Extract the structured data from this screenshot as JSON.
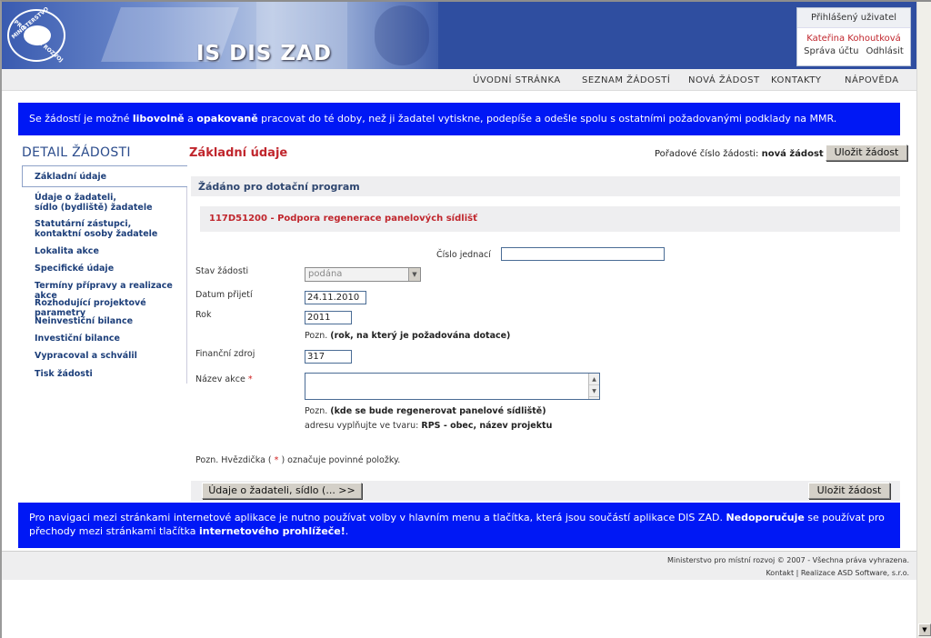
{
  "header": {
    "logo_line1": "MINISTERSTVO",
    "logo_line2": "PRO MÍSTNÍ ROZVOJ",
    "app_title": "IS DIS ZAD",
    "user_box": {
      "heading": "Přihlášený uživatel",
      "user_name": "Kateřina Kohoutková",
      "account_link": "Správa účtu",
      "logout_link": "Odhlásit"
    }
  },
  "nav": {
    "items": [
      "ÚVODNÍ STRÁNKA",
      "SEZNAM ŽÁDOSTÍ",
      "NOVÁ ŽÁDOST",
      "KONTAKTY",
      "NÁPOVĚDA"
    ]
  },
  "info_top": {
    "p1": "Se žádostí je možné ",
    "b1": "libovolně",
    "p2": " a ",
    "b2": "opakovaně",
    "p3": " pracovat do té doby, než ji žadatel vytiskne, podepíše a odešle spolu s ostatními požadovanými podklady na MMR."
  },
  "sidebar": {
    "title": "DETAIL ŽÁDOSTI",
    "items": [
      "Základní údaje",
      "Údaje o žadateli,",
      "sídlo (bydliště) žadatele",
      "Statutární zástupci,",
      "kontaktní osoby žadatele",
      "Lokalita akce",
      "Specifické údaje",
      "Termíny přípravy a realizace akce",
      "Rozhodující projektové parametry",
      "Neinvestiční bilance",
      "Investiční bilance",
      "Vypracoval a schválil",
      "Tisk žádosti"
    ]
  },
  "main": {
    "title": "Základní údaje",
    "seq_label": "Pořadové číslo žádosti:",
    "seq_value": "nová žádost",
    "save_label": "Uložit žádost",
    "panel_head": "Žádáno pro dotační program",
    "program": "117D51200 - Podpora regenerace panelových sídlišť",
    "fields": {
      "cislo_label": "Číslo jednací",
      "cislo_value": "",
      "stav_label": "Stav žádosti",
      "stav_value": "podána",
      "datum_label": "Datum přijetí",
      "datum_value": "24.11.2010",
      "rok_label": "Rok",
      "rok_value": "2011",
      "rok_note_prefix": "Pozn.",
      "rok_note": "(rok, na který je požadována dotace)",
      "zdroj_label": "Finanční zdroj",
      "zdroj_value": "317",
      "nazev_label": "Název akce",
      "nazev_required": "*",
      "nazev_note_prefix": "Pozn.",
      "nazev_note": "(kde se bude regenerovat panelové sídliště)",
      "nazev_hint_prefix": "adresu vyplňujte ve tvaru:",
      "nazev_hint": "RPS - obec, název projektu"
    },
    "required_note_p1": "Pozn. Hvězdička (",
    "required_star": "*",
    "required_note_p2": ") označuje povinné položky.",
    "next_label": "Údaje o žadateli, sídlo (... >>"
  },
  "info_bottom": {
    "p1": "Pro navigaci mezi stránkami internetové aplikace je nutno používat volby v hlavním menu a tlačítka, která jsou součástí aplikace DIS ZAD. ",
    "b1": "Nedoporučuje",
    "p2": " se používat pro přechody mezi stránkami tlačítka ",
    "b2": "internetového prohlížeče!",
    "p3": "."
  },
  "footer": {
    "line1": "Ministerstvo pro místní rozvoj © 2007 - Všechna práva vyhrazena.",
    "line2": "Kontakt | Realizace ASD Software, s.r.o."
  }
}
